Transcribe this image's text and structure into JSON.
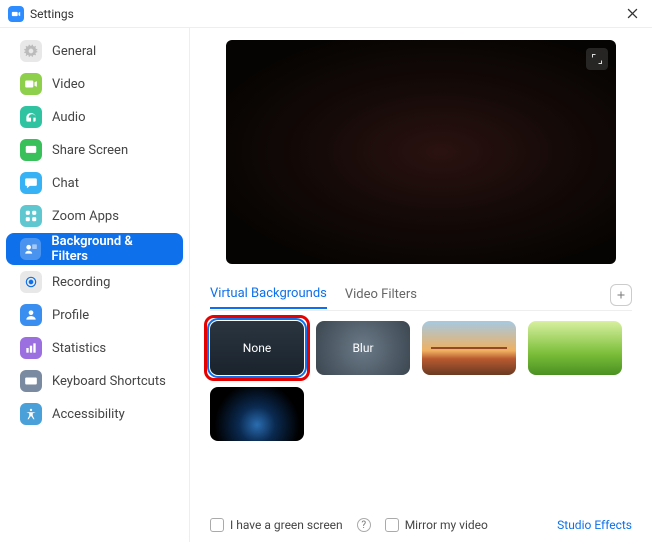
{
  "window": {
    "title": "Settings"
  },
  "sidebar": {
    "items": [
      {
        "id": "general",
        "label": "General",
        "icon_bg": "#e8e8e8",
        "icon_fg": "#bbbbbb",
        "svg": "gear"
      },
      {
        "id": "video",
        "label": "Video",
        "icon_bg": "#8ed04b",
        "icon_fg": "#ffffff",
        "svg": "video"
      },
      {
        "id": "audio",
        "label": "Audio",
        "icon_bg": "#2fc3a1",
        "icon_fg": "#ffffff",
        "svg": "headphones"
      },
      {
        "id": "share-screen",
        "label": "Share Screen",
        "icon_bg": "#39c05a",
        "icon_fg": "#ffffff",
        "svg": "share"
      },
      {
        "id": "chat",
        "label": "Chat",
        "icon_bg": "#36b2f5",
        "icon_fg": "#ffffff",
        "svg": "chat"
      },
      {
        "id": "zoom-apps",
        "label": "Zoom Apps",
        "icon_bg": "#5fc7d0",
        "icon_fg": "#ffffff",
        "svg": "apps"
      },
      {
        "id": "background-filters",
        "label": "Background & Filters",
        "icon_bg": "#ffffff",
        "icon_fg": "#0e71eb",
        "svg": "bgfilter",
        "active": true
      },
      {
        "id": "recording",
        "label": "Recording",
        "icon_bg": "#e8e8e8",
        "icon_fg": "#0e71eb",
        "svg": "record"
      },
      {
        "id": "profile",
        "label": "Profile",
        "icon_bg": "#3a8ef0",
        "icon_fg": "#ffffff",
        "svg": "profile"
      },
      {
        "id": "statistics",
        "label": "Statistics",
        "icon_bg": "#9b6fe0",
        "icon_fg": "#ffffff",
        "svg": "stats"
      },
      {
        "id": "keyboard-shortcuts",
        "label": "Keyboard Shortcuts",
        "icon_bg": "#7a8aa0",
        "icon_fg": "#ffffff",
        "svg": "keyboard"
      },
      {
        "id": "accessibility",
        "label": "Accessibility",
        "icon_bg": "#4aa0d8",
        "icon_fg": "#ffffff",
        "svg": "accessibility"
      }
    ]
  },
  "tabs": {
    "items": [
      {
        "id": "virtual-backgrounds",
        "label": "Virtual Backgrounds",
        "active": true
      },
      {
        "id": "video-filters",
        "label": "Video Filters"
      }
    ]
  },
  "backgrounds": {
    "options": [
      {
        "id": "none",
        "label": "None",
        "cls": "bg-none",
        "selected": true,
        "highlighted": true
      },
      {
        "id": "blur",
        "label": "Blur",
        "cls": "bg-blur"
      },
      {
        "id": "bridge",
        "label": "",
        "cls": "bg-bridge"
      },
      {
        "id": "grass",
        "label": "",
        "cls": "bg-grass"
      },
      {
        "id": "earth",
        "label": "",
        "cls": "bg-earth"
      }
    ]
  },
  "bottom": {
    "green_screen_label": "I have a green screen",
    "mirror_label": "Mirror my video",
    "studio_effects_label": "Studio Effects"
  }
}
